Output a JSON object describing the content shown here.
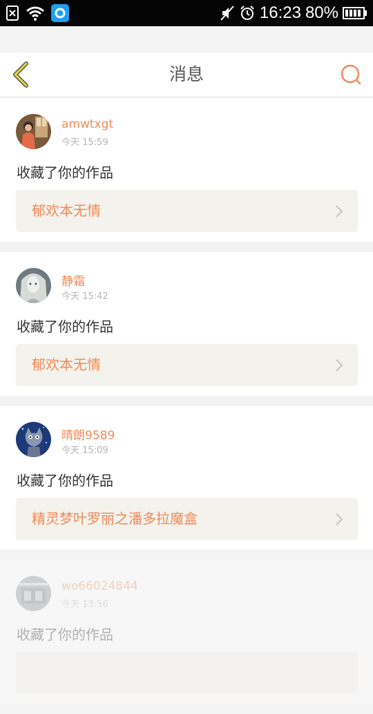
{
  "status_bar": {
    "time": "16:23",
    "battery": "80%"
  },
  "header": {
    "title": "消息"
  },
  "messages": [
    {
      "username": "amwtxgt",
      "time": "今天 15:59",
      "action": "收藏了你的作品",
      "work_title": "郁欢本无情"
    },
    {
      "username": "静霜",
      "time": "今天 15:42",
      "action": "收藏了你的作品",
      "work_title": "郁欢本无情"
    },
    {
      "username": "晴朗9589",
      "time": "今天 15:09",
      "action": "收藏了你的作品",
      "work_title": "精灵梦叶罗丽之潘多拉魔盒"
    },
    {
      "username": "wo66024844",
      "time": "今天 13:56",
      "action": "收藏了你的作品",
      "work_title": ""
    }
  ],
  "colors": {
    "accent": "#f08a5a",
    "back_icon": "#d9c41a",
    "card_bg": "#ffffff",
    "page_bg": "#f3f3f3"
  }
}
